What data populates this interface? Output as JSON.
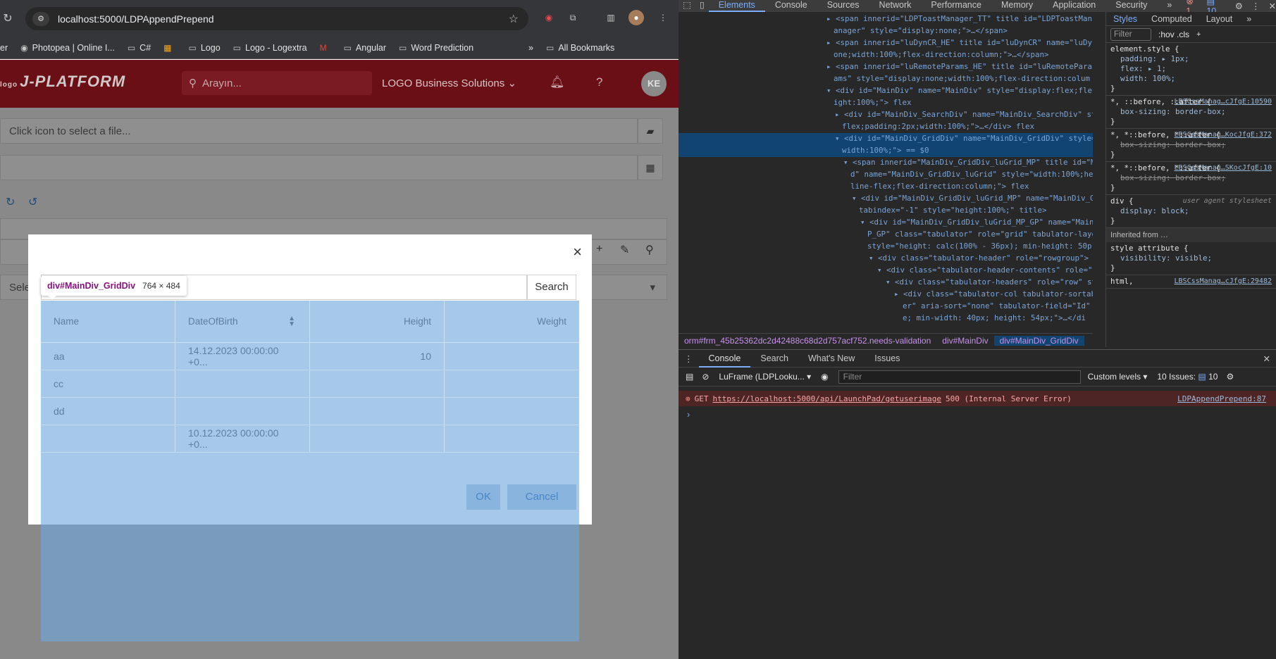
{
  "browser": {
    "url": "localhost:5000/LDPAppendPrepend",
    "bookmarks": [
      "er",
      "Photopea | Online I...",
      "C#",
      "Logo",
      "Logo - Logextra",
      "Angular",
      "Word Prediction",
      "All Bookmarks"
    ],
    "more": "»"
  },
  "app": {
    "logo_small": "logo",
    "logo": "J-PLATFORM",
    "search_placeholder": "Arayın...",
    "company": "LOGO Business Solutions",
    "avatar": "KE",
    "file_placeholder": "Click icon to select a file...",
    "select_placeholder": "Sele"
  },
  "dialog": {
    "search_button": "Search",
    "close": "×",
    "ok": "OK",
    "cancel": "Cancel",
    "columns": [
      "Name",
      "DateOfBirth",
      "Height",
      "Weight"
    ],
    "rows": [
      [
        "aa",
        "14.12.2023 00:00:00 +0...",
        "10",
        ""
      ],
      [
        "cc",
        "",
        "",
        ""
      ],
      [
        "dd",
        "",
        "",
        ""
      ],
      [
        "",
        "10.12.2023 00:00:00 +0...",
        "",
        ""
      ]
    ]
  },
  "inspector_tip": {
    "selector": "div#MainDiv_GridDiv",
    "size": "764 × 484"
  },
  "devtools": {
    "tabs": [
      "Elements",
      "Console",
      "Sources",
      "Network",
      "Performance",
      "Memory",
      "Application",
      "Security",
      "»"
    ],
    "error_count": "1",
    "issue_count": "10",
    "element_lines": [
      "<span innerid=\"LDPToastManager_TT\" title id=\"LDPToastMan",
      "anager\" style=\"display:none;\">…</span>",
      "<span innerid=\"luDynCR_HE\" title id=\"luDynCR\" name=\"luDyn",
      "one;width:100%;flex-direction:column;\">…</span>",
      "<span innerid=\"luRemoteParams_HE\" title id=\"luRemoteParar",
      "ams\" style=\"display:none;width:100%;flex-direction:colum",
      "<div id=\"MainDiv\" name=\"MainDiv\" style=\"display:flex;fle",
      "ight:100%;\"> flex",
      "<div id=\"MainDiv_SearchDiv\" name=\"MainDiv_SearchDiv\" st",
      "flex;padding:2px;width:100%;\">…</div> flex",
      "<div id=\"MainDiv_GridDiv\" name=\"MainDiv_GridDiv\" style=",
      "width:100%;\"> == $0",
      "<span innerid=\"MainDiv_GridDiv_luGrid_MP\" title id=\"M",
      "d\" name=\"MainDiv_GridDiv_luGrid\" style=\"width:100%;he",
      "line-flex;flex-direction:column;\"> flex",
      "<div id=\"MainDiv_GridDiv_luGrid_MP\" name=\"MainDiv_G",
      "tabindex=\"-1\" style=\"height:100%;\" title>",
      "<div id=\"MainDiv_GridDiv_luGrid_MP_GP\" name=\"MainD",
      "P_GP\" class=\"tabulator\" role=\"grid\" tabulator-layo",
      "style=\"height: calc(100% - 36px); min-height: 50p",
      "<div class=\"tabulator-header\" role=\"rowgroup\">",
      "<div class=\"tabulator-header-contents\" role=\"r",
      "<div class=\"tabulator-headers\" role=\"row\" st",
      "<div class=\"tabulator-col tabulator-sortab",
      "er\" aria-sort=\"none\" tabulator-field=\"Id\"",
      "e; min-width: 40px; height: 54px;\">…</di"
    ],
    "breadcrumbs": [
      "orm#frm_45b25362dc2d42488c68d2d757acf752.needs-validation",
      "div#MainDiv",
      "div#MainDiv_GridDiv"
    ],
    "styles_tabs": [
      "Styles",
      "Computed",
      "Layout",
      "»"
    ],
    "styles_filter": "Filter",
    "styles_hov": ":hov .cls",
    "rules": [
      {
        "selector": "element.style {",
        "source": "",
        "props": [
          "padding: ▸ 1px;",
          "flex: ▸ 1;",
          "width: 100%;"
        ],
        "struck": false
      },
      {
        "selector": "*, ::before, ::after {",
        "source": "LBSCssManag…cJfgE:10590",
        "props": [
          "box-sizing: border-box;"
        ],
        "struck": false
      },
      {
        "selector": "*, *::before, *::after {",
        "source": "LBSCssManag…KocJfgE:372",
        "props": [
          "box-sizing: border-box;"
        ],
        "struck": true
      },
      {
        "selector": "*, *::before, *::after {",
        "source": "LBSCssManag…SKocJfgE:10",
        "props": [
          "box-sizing: border-box;"
        ],
        "struck": true
      },
      {
        "selector": "div {",
        "source": "user agent stylesheet",
        "props": [
          "display: block;"
        ],
        "struck": false
      }
    ],
    "inherited": "Inherited from …",
    "style_attr": {
      "selector": "style attribute {",
      "props": [
        "visibility: visible;"
      ]
    },
    "html_rule": {
      "selector": "html,",
      "source": "LBSCssManag…cJfgE:29482"
    },
    "drawer_tabs": [
      "Console",
      "Search",
      "What's New",
      "Issues"
    ],
    "context": "LuFrame (LDPLooku...",
    "console_filter": "Filter",
    "levels": "Custom levels",
    "issues": "10 Issues:",
    "issues_n": "10",
    "error": {
      "method": "GET",
      "url": "https://localhost:5000/api/LaunchPad/getuserimage",
      "status": "500 (Internal Server Error)",
      "location": "LDPAppendPrepend:87"
    },
    "prompt": "›"
  }
}
